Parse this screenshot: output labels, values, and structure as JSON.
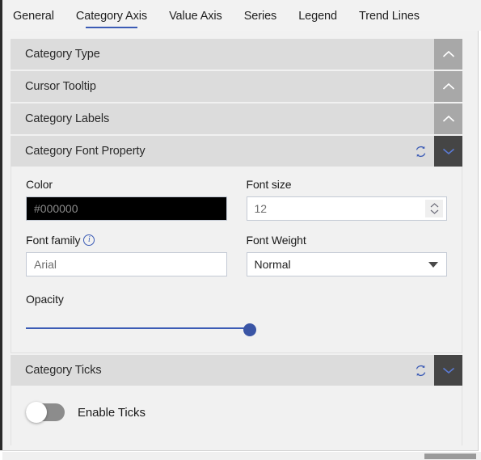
{
  "tabs": [
    {
      "label": "General",
      "active": false
    },
    {
      "label": "Category Axis",
      "active": true
    },
    {
      "label": "Value Axis",
      "active": false
    },
    {
      "label": "Series",
      "active": false
    },
    {
      "label": "Legend",
      "active": false
    },
    {
      "label": "Trend Lines",
      "active": false
    }
  ],
  "sections": {
    "category_type": {
      "title": "Category Type",
      "state": "collapsed",
      "chevron": "chevron-up-icon"
    },
    "cursor_tooltip": {
      "title": "Cursor Tooltip",
      "state": "collapsed",
      "chevron": "chevron-up-icon"
    },
    "category_labels": {
      "title": "Category Labels",
      "state": "collapsed",
      "chevron": "chevron-up-icon"
    },
    "category_font_property": {
      "title": "Category Font Property",
      "state": "expanded",
      "chevron": "chevron-down-icon",
      "reset_icon": "refresh-icon"
    },
    "category_ticks": {
      "title": "Category Ticks",
      "state": "expanded",
      "chevron": "chevron-down-icon",
      "reset_icon": "refresh-icon"
    }
  },
  "font_property": {
    "color": {
      "label": "Color",
      "value": "#000000",
      "swatch": "#000000"
    },
    "font_size": {
      "label": "Font size",
      "value": "12"
    },
    "font_family": {
      "label": "Font family",
      "value": "Arial",
      "info_icon": "info-icon"
    },
    "font_weight": {
      "label": "Font Weight",
      "value": "Normal"
    },
    "opacity": {
      "label": "Opacity",
      "value": 100
    }
  },
  "ticks": {
    "enable": {
      "label": "Enable Ticks",
      "checked": false
    }
  },
  "colors": {
    "accent": "#3b5bb5",
    "slider": "#3a55a5",
    "header_bg": "#dcdcdc",
    "panel_bg": "#f1f1f1",
    "chevron_collapsed_bg": "#a8a8a8",
    "chevron_expanded_bg": "#454545"
  }
}
